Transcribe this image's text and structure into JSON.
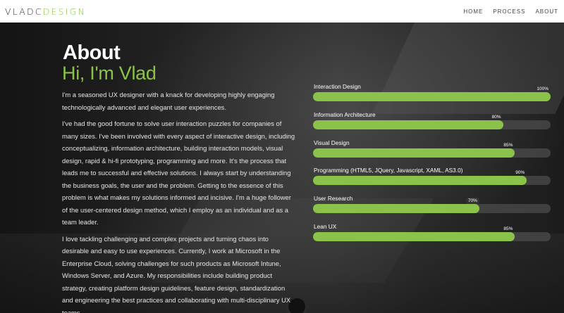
{
  "header": {
    "logo_left": "VLADC",
    "logo_right": "DESIGN",
    "nav": [
      "HOME",
      "PROCESS",
      "ABOUT"
    ]
  },
  "about": {
    "title": "About",
    "subtitle": "Hi, I'm Vlad",
    "paragraphs": [
      "I'm a seasoned UX designer with a knack for developing highly engaging technologically advanced and elegant user experiences.",
      "I've had the good fortune to solve user interaction puzzles for companies of many sizes. I've been involved with every aspect of interactive design, including conceptualizing, information architecture, building interaction models, visual design, rapid & hi-fi prototyping, programming and more. It's the process that leads me to successful and effective solutions. I always start by understanding the business goals, the user and the problem. Getting to the essence of this problem is what makes my solutions informed and incisive. I'm a huge follower of the user-centered design method, which I employ as an individual and as a team leader.",
      "I love tackling challenging and complex projects and turning chaos into desirable and easy to use experiences. Currently, I work at Microsoft in the Enterprise Cloud, solving challenges for such products as Microsoft Intune, Windows Server, and Azure. My responsibilities include building product strategy, creating platform design guidelines, feature design, standardization and engineering the best practices and collaborating with multi-disciplinary UX teams."
    ]
  },
  "skills": [
    {
      "label": "Interaction Design",
      "value": 100,
      "pct": "100%"
    },
    {
      "label": "Information Architecture",
      "value": 80,
      "pct": "80%"
    },
    {
      "label": "Visual Design",
      "value": 85,
      "pct": "85%"
    },
    {
      "label": "Programming (HTML5, JQuery, Javascript, XAML, AS3.0)",
      "value": 90,
      "pct": "90%"
    },
    {
      "label": "User Research",
      "value": 70,
      "pct": "70%"
    },
    {
      "label": "Lean UX",
      "value": 85,
      "pct": "85%"
    }
  ],
  "colors": {
    "accent": "#8bc34a",
    "track": "#464646",
    "background": "#1d1d1d"
  }
}
